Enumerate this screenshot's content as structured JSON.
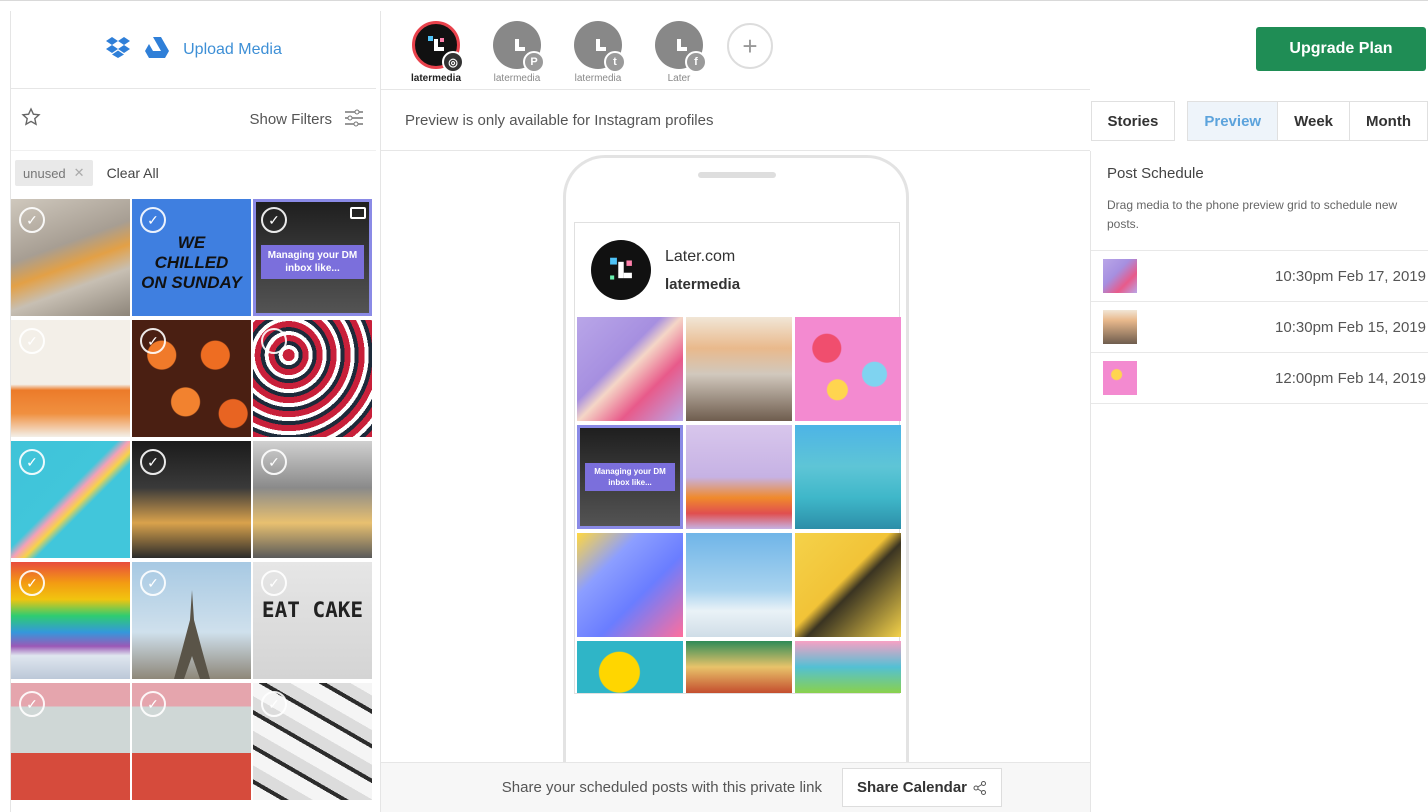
{
  "library": {
    "upload_label": "Upload Media",
    "show_filters_label": "Show Filters",
    "tag_label": "unused",
    "tag_remove": "✕",
    "clear_all_label": "Clear All",
    "cell_texts": {
      "c2": "WE CHILLED ON SUNDAY",
      "c3": "Managing your DM inbox like...",
      "c14": "EAT CAKE"
    },
    "check_glyph": "✓"
  },
  "profiles": {
    "items": [
      {
        "label": "latermedia",
        "network": "instagram",
        "badge": "◎"
      },
      {
        "label": "latermedia",
        "network": "pinterest",
        "badge": "P"
      },
      {
        "label": "latermedia",
        "network": "twitter",
        "badge": "t"
      },
      {
        "label": "Later",
        "network": "facebook",
        "badge": "f"
      }
    ],
    "add_glyph": "+"
  },
  "preview": {
    "notice": "Preview is only available for Instagram profiles",
    "display_name": "Later.com",
    "handle": "latermedia",
    "grid_texts": {
      "g4": "Managing your DM inbox like..."
    }
  },
  "share": {
    "text": "Share your scheduled posts with this private link",
    "button_label": "Share Calendar",
    "button_icon": "share-icon"
  },
  "header": {
    "upgrade_label": "Upgrade Plan"
  },
  "view_tabs": {
    "stories": "Stories",
    "preview": "Preview",
    "week": "Week",
    "month": "Month",
    "active": "preview"
  },
  "schedule": {
    "title": "Post Schedule",
    "description": "Drag media to the phone preview grid to schedule new posts.",
    "items": [
      {
        "time": "10:30pm Feb 17, 2019"
      },
      {
        "time": "10:30pm Feb 15, 2019"
      },
      {
        "time": "12:00pm Feb 14, 2019"
      }
    ]
  },
  "colors": {
    "accent_blue": "#3d8fd6",
    "upgrade_green": "#1f8d55",
    "active_profile_ring": "#e8424c"
  }
}
